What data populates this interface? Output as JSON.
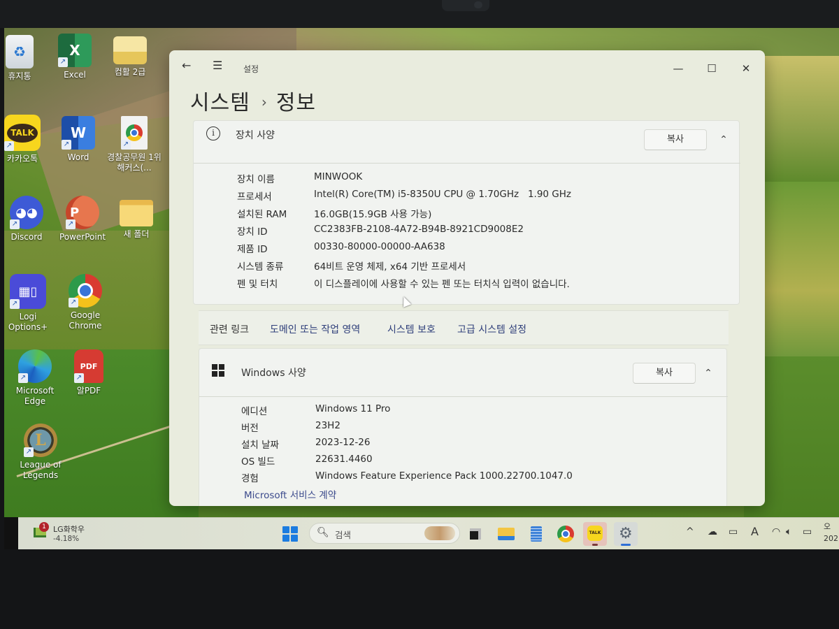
{
  "desktop": {
    "icons": [
      {
        "label": "휴지통",
        "icon": "recycle-bin-icon"
      },
      {
        "label": "Excel",
        "icon": "excel-icon"
      },
      {
        "label": "컴활 2급",
        "icon": "folder-icon"
      },
      {
        "label": "카카오톡",
        "icon": "kakaotalk-icon"
      },
      {
        "label": "Word",
        "icon": "word-icon"
      },
      {
        "label": "경찰공무원 1위 해커스(...",
        "icon": "chrome-shortcut-icon"
      },
      {
        "label": "Discord",
        "icon": "discord-icon"
      },
      {
        "label": "PowerPoint",
        "icon": "powerpoint-icon"
      },
      {
        "label": "새 폴더",
        "icon": "folder-icon"
      },
      {
        "label": "Logi Options+",
        "icon": "logi-options-icon"
      },
      {
        "label": "Google Chrome",
        "icon": "chrome-icon"
      },
      {
        "label": "Microsoft Edge",
        "icon": "edge-icon"
      },
      {
        "label": "알PDF",
        "icon": "alpdf-icon"
      },
      {
        "label": "League of Legends",
        "icon": "league-of-legends-icon"
      }
    ],
    "glyphs": {
      "excel": "X",
      "word": "W",
      "powerpoint": "P",
      "talk": "TALK",
      "pdf": "PDF",
      "lol": "L"
    }
  },
  "window": {
    "app_title": "설정",
    "back_icon": "←",
    "menu_icon": "☰",
    "minimize": "—",
    "maximize": "☐",
    "close": "✕",
    "breadcrumb": {
      "parent": "시스템",
      "separator": "›",
      "current": "정보"
    }
  },
  "device_specs": {
    "title": "장치 사양",
    "info_icon": "i",
    "copy_label": "복사",
    "collapse_icon": "⌃",
    "rows": [
      {
        "key": "장치 이름",
        "value": "MINWOOK"
      },
      {
        "key": "프로세서",
        "value": "Intel(R) Core(TM) i5-8350U CPU @ 1.70GHz   1.90 GHz"
      },
      {
        "key": "설치된 RAM",
        "value": "16.0GB(15.9GB 사용 가능)"
      },
      {
        "key": "장치 ID",
        "value": "CC2383FB-2108-4A72-B94B-8921CD9008E2"
      },
      {
        "key": "제품 ID",
        "value": "00330-80000-00000-AA638"
      },
      {
        "key": "시스템 종류",
        "value": "64비트 운영 체제, x64 기반 프로세서"
      },
      {
        "key": "펜 및 터치",
        "value": "이 디스플레이에 사용할 수 있는 펜 또는 터치식 입력이 없습니다."
      }
    ]
  },
  "related_links": {
    "label": "관련 링크",
    "links": [
      "도메인 또는 작업 영역",
      "시스템 보호",
      "고급 시스템 설정"
    ]
  },
  "windows_specs": {
    "title": "Windows 사양",
    "copy_label": "복사",
    "collapse_icon": "⌃",
    "rows": [
      {
        "key": "에디션",
        "value": "Windows 11 Pro"
      },
      {
        "key": "버전",
        "value": "23H2"
      },
      {
        "key": "설치 날짜",
        "value": "2023-12-26"
      },
      {
        "key": "OS 빌드",
        "value": "22631.4460"
      },
      {
        "key": "경험",
        "value": "Windows Feature Experience Pack 1000.22700.1047.0"
      }
    ],
    "link": "Microsoft 서비스 계약"
  },
  "taskbar": {
    "widget": {
      "badge": "1",
      "title": "LG화학우",
      "change": "-4.18%"
    },
    "search_placeholder": "검색",
    "search_icon": "⚲",
    "apps": [
      "task-view",
      "file-explorer",
      "notepad",
      "chrome",
      "kakaotalk",
      "settings"
    ],
    "tray": {
      "chevron": "^",
      "lang": "A"
    },
    "clock": {
      "line1": "오",
      "line2": "202"
    }
  }
}
